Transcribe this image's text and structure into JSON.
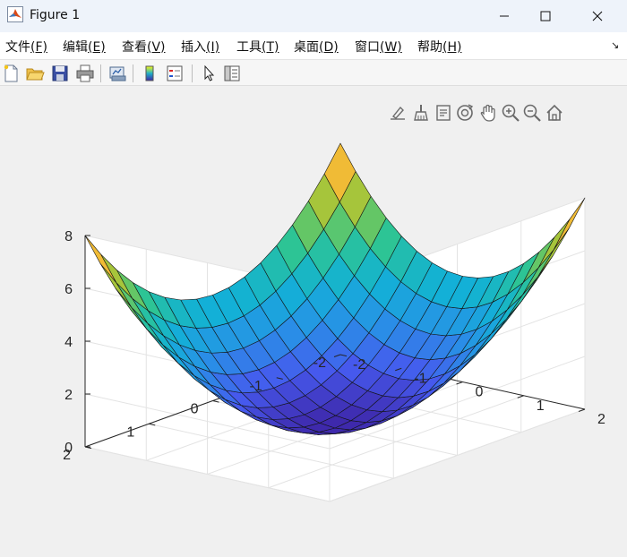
{
  "window": {
    "title": "Figure 1",
    "minimize_glyph": "—",
    "maximize_glyph": "☐",
    "close_glyph": "✕",
    "app_icon": "matlab-logo-icon"
  },
  "menubar": {
    "items": [
      {
        "label": "文件",
        "key": "(F)"
      },
      {
        "label": "编辑",
        "key": "(E)"
      },
      {
        "label": "查看",
        "key": "(V)"
      },
      {
        "label": "插入",
        "key": "(I)"
      },
      {
        "label": "工具",
        "key": "(T)"
      },
      {
        "label": "桌面",
        "key": "(D)"
      },
      {
        "label": "窗口",
        "key": "(W)"
      },
      {
        "label": "帮助",
        "key": "(H)"
      }
    ],
    "overflow_glyph": "↘"
  },
  "toolbar": {
    "icons": [
      "new-figure-icon",
      "open-file-icon",
      "save-icon",
      "print-icon",
      "link-plot-icon",
      "colorbar-icon",
      "legend-icon",
      "edit-plot-icon",
      "property-inspector-icon"
    ]
  },
  "axes_toolbar": {
    "icons": [
      "brush-edit-icon",
      "data-brush-icon",
      "data-tips-icon",
      "rotate-3d-icon",
      "pan-icon",
      "zoom-in-icon",
      "zoom-out-icon",
      "restore-view-icon"
    ]
  },
  "chart_data": {
    "type": "surface",
    "function": "z = x^2 + y^2",
    "x": [
      -2,
      -1.75,
      -1.5,
      -1.25,
      -1,
      -0.75,
      -0.5,
      -0.25,
      0,
      0.25,
      0.5,
      0.75,
      1,
      1.25,
      1.5,
      1.75,
      2
    ],
    "y": [
      -2,
      -1.75,
      -1.5,
      -1.25,
      -1,
      -0.75,
      -0.5,
      -0.25,
      0,
      0.25,
      0.5,
      0.75,
      1,
      1.25,
      1.5,
      1.75,
      2
    ],
    "xlim": [
      -2,
      2
    ],
    "ylim": [
      -2,
      2
    ],
    "zlim": [
      0,
      8
    ],
    "x_ticks": [
      "-2",
      "-1",
      "0",
      "1",
      "2"
    ],
    "y_ticks": [
      "-2",
      "-1",
      "0",
      "1",
      "2"
    ],
    "z_ticks": [
      "0",
      "2",
      "4",
      "6",
      "8"
    ],
    "colormap": "parula",
    "grid": true,
    "view": "3d-default"
  }
}
